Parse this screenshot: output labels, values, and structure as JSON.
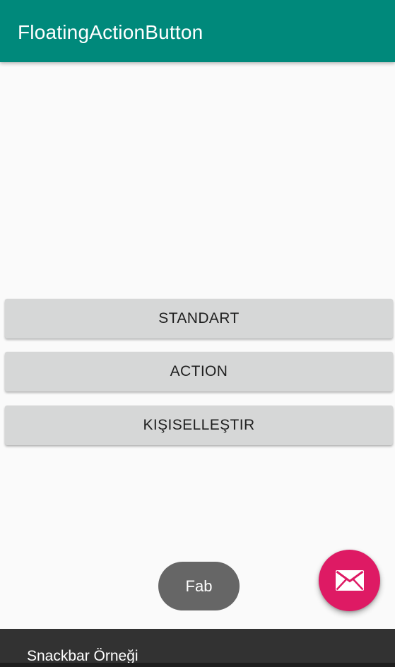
{
  "app_bar": {
    "title": "FloatingActionButton",
    "color": "#00897b"
  },
  "buttons": {
    "standart_label": "STANDART",
    "action_label": "ACTION",
    "custom_label": "KIŞISELLEŞTIR"
  },
  "toast": {
    "text": "Fab"
  },
  "fab": {
    "icon": "mail-icon",
    "color": "#de1a64"
  },
  "snackbar": {
    "text": "Snackbar Örneği"
  }
}
